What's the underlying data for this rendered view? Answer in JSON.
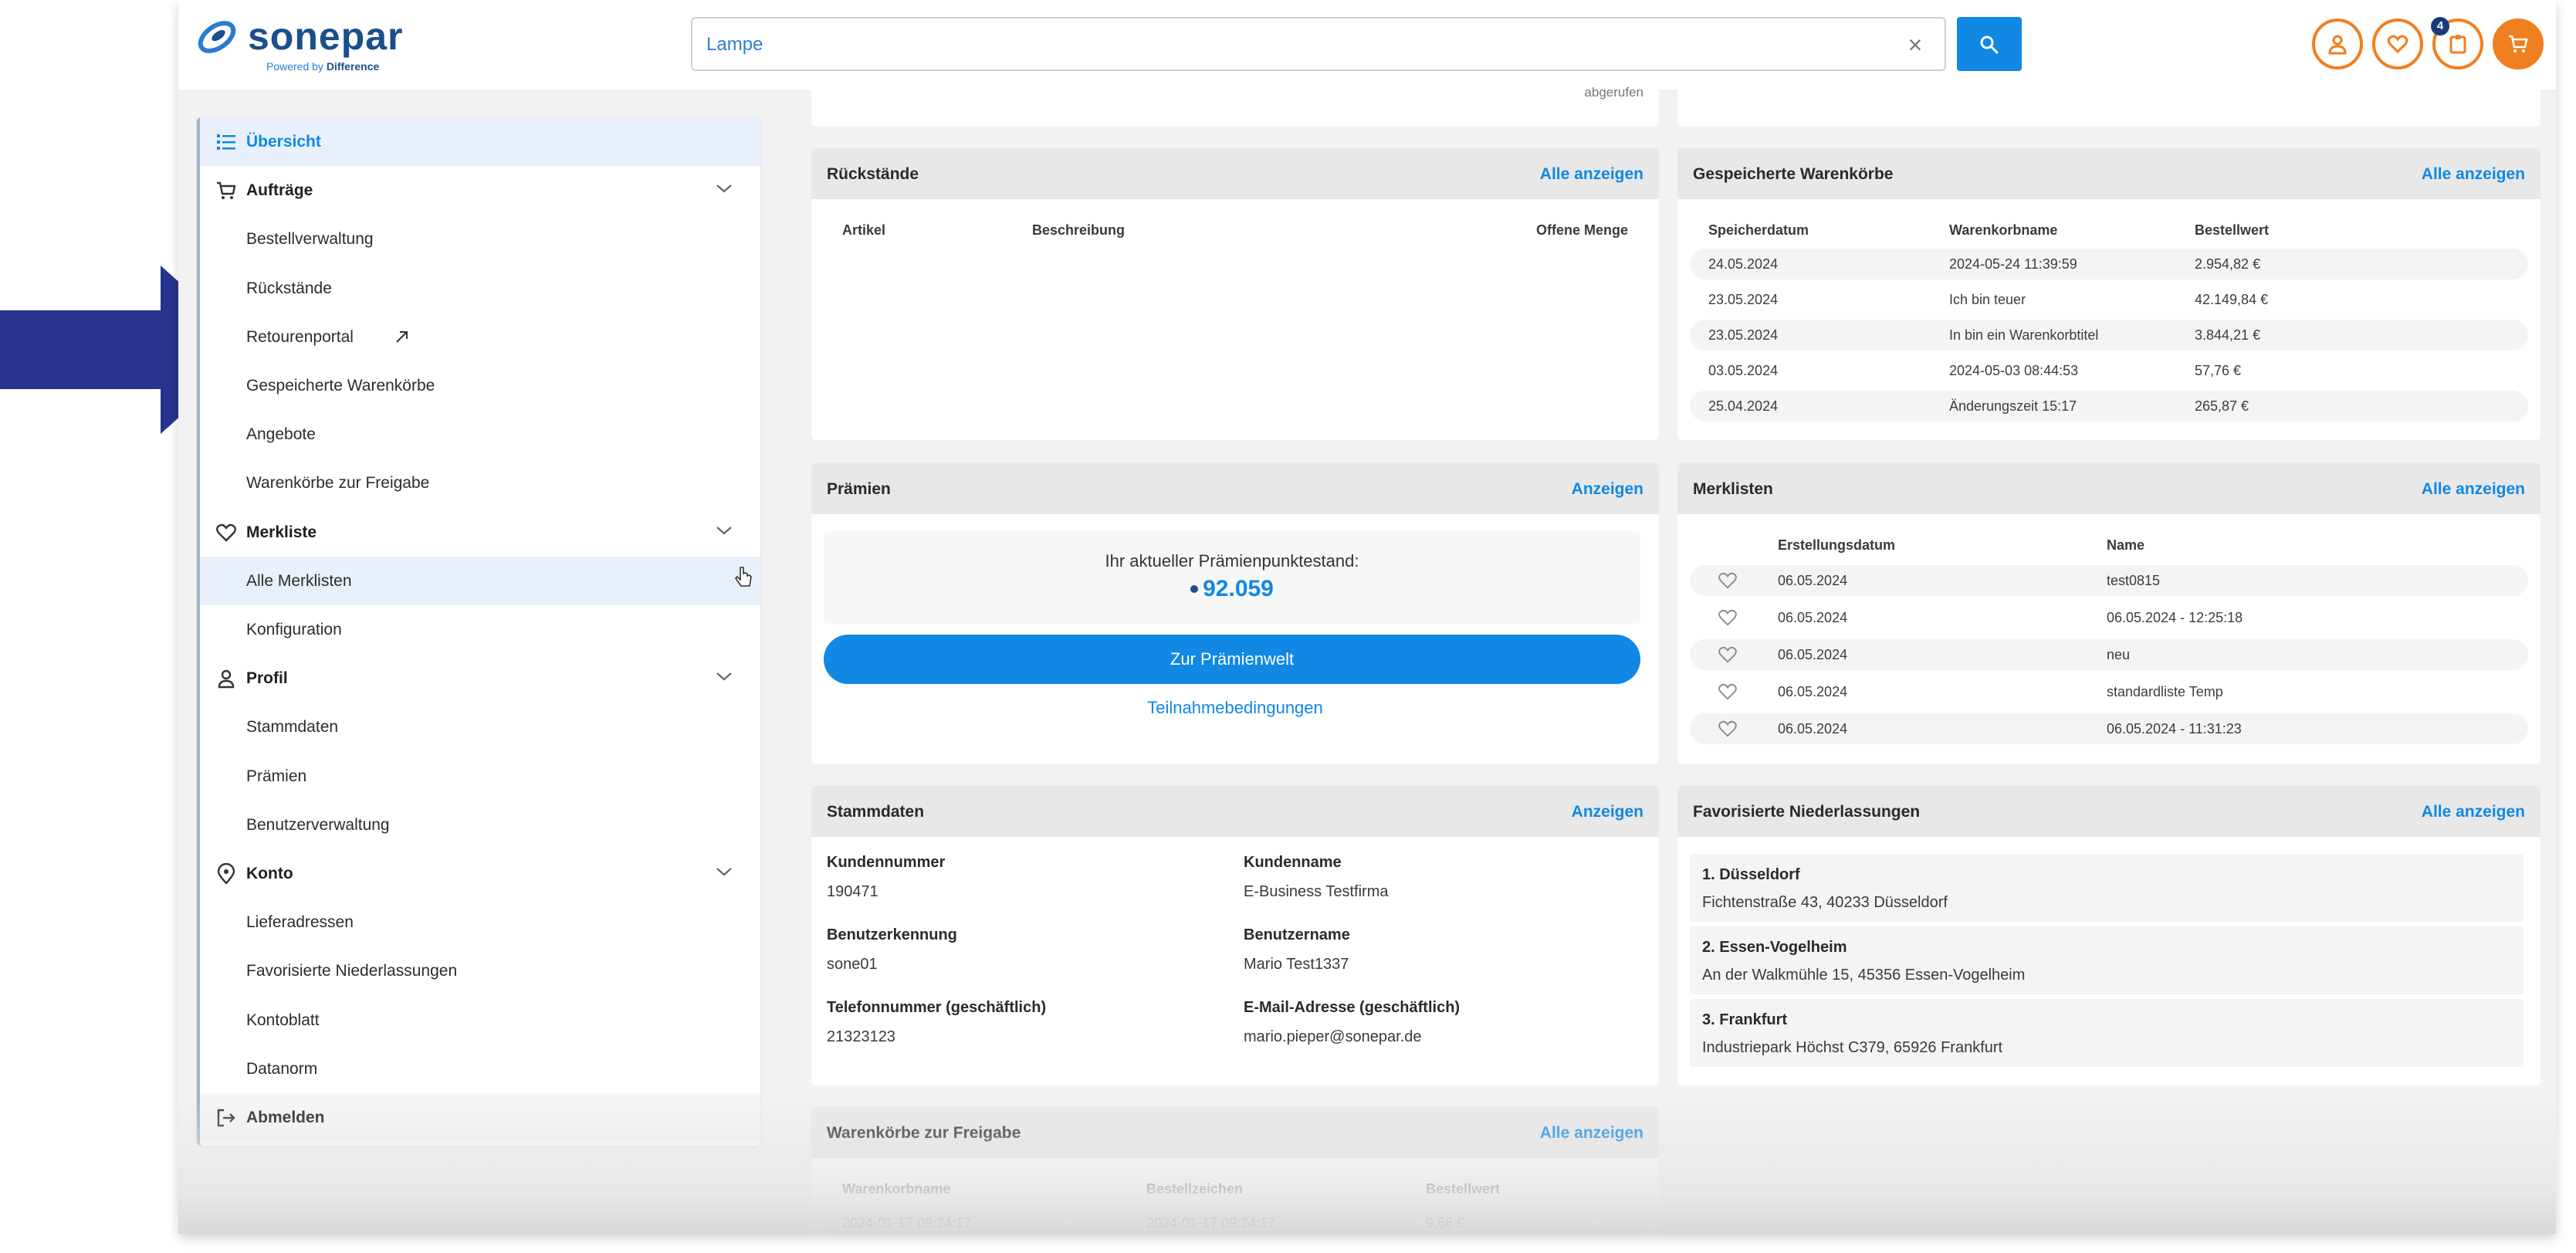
{
  "header": {
    "logo_name": "sonepar",
    "logo_tagline_prefix": "Powered by ",
    "logo_tagline_brand": "Difference",
    "search_value": "Lampe",
    "search_clear": "×",
    "cart_badge": "4"
  },
  "sidebar": {
    "items": [
      {
        "label": "Übersicht",
        "type": "section",
        "icon": "list-icon",
        "active": true
      },
      {
        "label": "Aufträge",
        "type": "section",
        "icon": "cart-icon",
        "chevron": true
      },
      {
        "label": "Bestellverwaltung",
        "type": "sub"
      },
      {
        "label": "Rückstände",
        "type": "sub"
      },
      {
        "label": "Retourenportal",
        "type": "sub",
        "external": true
      },
      {
        "label": "Gespeicherte Warenkörbe",
        "type": "sub"
      },
      {
        "label": "Angebote",
        "type": "sub"
      },
      {
        "label": "Warenkörbe zur Freigabe",
        "type": "sub"
      },
      {
        "label": "Merkliste",
        "type": "section",
        "icon": "heart-icon",
        "chevron": true
      },
      {
        "label": "Alle Merklisten",
        "type": "sub",
        "active": true
      },
      {
        "label": "Konfiguration",
        "type": "sub"
      },
      {
        "label": "Profil",
        "type": "section",
        "icon": "user-icon",
        "chevron": true
      },
      {
        "label": "Stammdaten",
        "type": "sub"
      },
      {
        "label": "Prämien",
        "type": "sub"
      },
      {
        "label": "Benutzerverwaltung",
        "type": "sub"
      },
      {
        "label": "Konto",
        "type": "section",
        "icon": "location-icon",
        "chevron": true
      },
      {
        "label": "Lieferadressen",
        "type": "sub"
      },
      {
        "label": "Favorisierte Niederlassungen",
        "type": "sub"
      },
      {
        "label": "Kontoblatt",
        "type": "sub"
      },
      {
        "label": "Datanorm",
        "type": "sub"
      },
      {
        "label": "Abmelden",
        "type": "section",
        "icon": "logout-icon"
      }
    ]
  },
  "top_partial": {
    "text": "abgerufen"
  },
  "rueckstaende": {
    "title": "Rückstände",
    "link": "Alle anzeigen",
    "columns": [
      "Artikel",
      "Beschreibung",
      "Offene Menge"
    ]
  },
  "warenkoerbe": {
    "title": "Gespeicherte Warenkörbe",
    "link": "Alle anzeigen",
    "columns": [
      "Speicherdatum",
      "Warenkorbname",
      "Bestellwert"
    ],
    "rows": [
      [
        "24.05.2024",
        "2024-05-24 11:39:59",
        "2.954,82 €"
      ],
      [
        "23.05.2024",
        "Ich bin teuer",
        "42.149,84 €"
      ],
      [
        "23.05.2024",
        "In bin ein Warenkorbtitel",
        "3.844,21 €"
      ],
      [
        "03.05.2024",
        "2024-05-03 08:44:53",
        "57,76 €"
      ],
      [
        "25.04.2024",
        "Änderungszeit 15:17",
        "265,87 €"
      ]
    ]
  },
  "praemien": {
    "title": "Prämien",
    "link": "Anzeigen",
    "points_label": "Ihr aktueller Prämienpunktestand:",
    "points_value": "92.059",
    "button": "Zur Prämienwelt",
    "terms": "Teilnahmebedingungen"
  },
  "merklisten": {
    "title": "Merklisten",
    "link": "Alle anzeigen",
    "columns": [
      "Erstellungsdatum",
      "Name"
    ],
    "rows": [
      [
        "06.05.2024",
        "test0815"
      ],
      [
        "06.05.2024",
        "06.05.2024 - 12:25:18"
      ],
      [
        "06.05.2024",
        "neu"
      ],
      [
        "06.05.2024",
        "standardliste Temp"
      ],
      [
        "06.05.2024",
        "06.05.2024 - 11:31:23"
      ]
    ]
  },
  "stammdaten": {
    "title": "Stammdaten",
    "link": "Anzeigen",
    "fields": [
      {
        "label": "Kundennummer",
        "value": "190471"
      },
      {
        "label": "Kundenname",
        "value": "E-Business Testfirma"
      },
      {
        "label": "Benutzerkennung",
        "value": "sone01"
      },
      {
        "label": "Benutzername",
        "value": "Mario Test1337"
      },
      {
        "label": "Telefonnummer (geschäftlich)",
        "value": "21323123"
      },
      {
        "label": "E-Mail-Adresse (geschäftlich)",
        "value": "mario.pieper@sonepar.de"
      }
    ]
  },
  "niederlassungen": {
    "title": "Favorisierte Niederlassungen",
    "link": "Alle anzeigen",
    "branches": [
      {
        "name": "1. Düsseldorf",
        "address": "Fichtenstraße 43, 40233 Düsseldorf"
      },
      {
        "name": "2. Essen-Vogelheim",
        "address": "An der Walkmühle 15, 45356 Essen-Vogelheim"
      },
      {
        "name": "3. Frankfurt",
        "address": "Industriepark Höchst C379, 65926 Frankfurt"
      }
    ]
  },
  "freigabe": {
    "title": "Warenkörbe zur Freigabe",
    "link": "Alle anzeigen",
    "columns": [
      "Warenkorbname",
      "Bestellzeichen",
      "Bestellwert"
    ],
    "rows": [
      [
        "2024-01-17 09:24:17",
        "2024-01-17 09:24:17",
        "9,66 €"
      ]
    ]
  },
  "colors": {
    "accent": "#1088e4",
    "brand": "#1a4f8c",
    "orange": "#f07f1f",
    "arrow": "#27338c"
  }
}
